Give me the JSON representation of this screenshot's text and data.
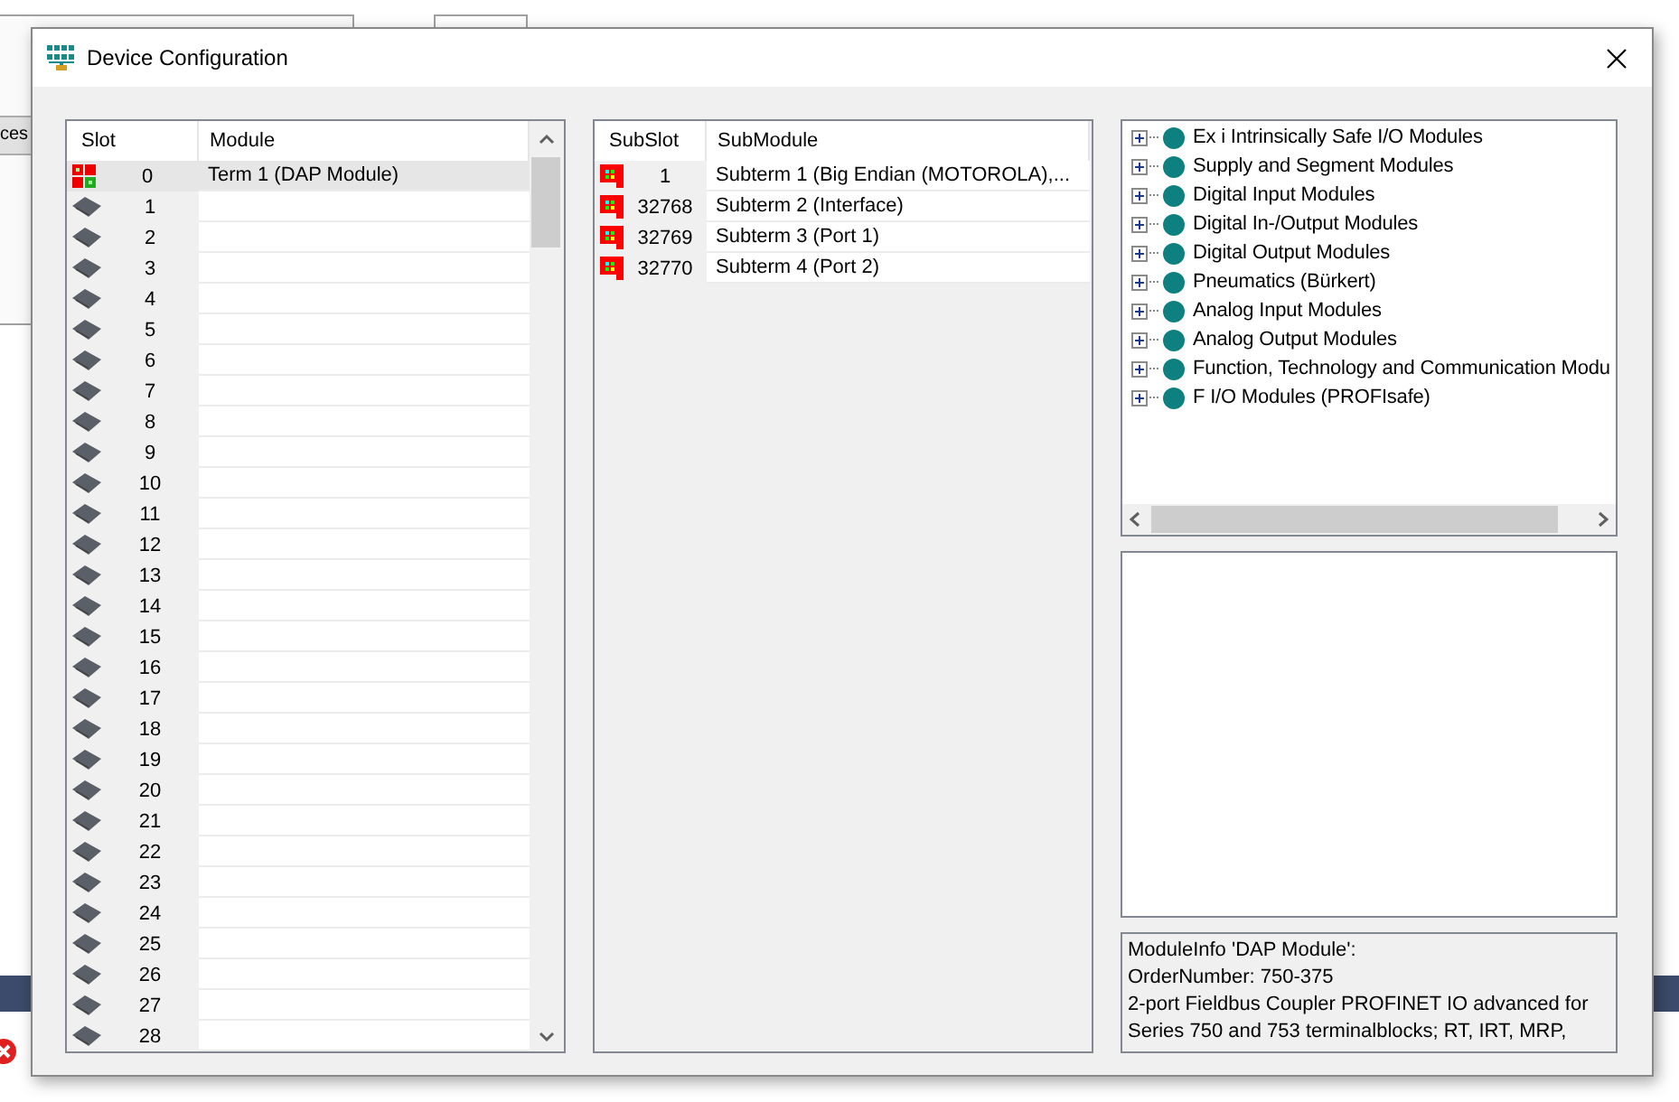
{
  "background": {
    "fragment": "ces"
  },
  "window": {
    "title": "Device Configuration"
  },
  "slot_table": {
    "columns": [
      "Slot",
      "Module"
    ],
    "rows": [
      {
        "slot": "0",
        "module": "Term 1 (DAP Module)",
        "kind": "dap",
        "selected": true
      },
      {
        "slot": "1",
        "kind": "empty",
        "selected": false
      },
      {
        "slot": "2",
        "kind": "empty",
        "selected": false
      },
      {
        "slot": "3",
        "kind": "empty",
        "selected": false
      },
      {
        "slot": "4",
        "kind": "empty",
        "selected": false
      },
      {
        "slot": "5",
        "kind": "empty",
        "selected": false
      },
      {
        "slot": "6",
        "kind": "empty",
        "selected": false
      },
      {
        "slot": "7",
        "kind": "empty",
        "selected": false
      },
      {
        "slot": "8",
        "kind": "empty",
        "selected": false
      },
      {
        "slot": "9",
        "kind": "empty",
        "selected": false
      },
      {
        "slot": "10",
        "kind": "empty",
        "selected": false
      },
      {
        "slot": "11",
        "kind": "empty",
        "selected": false
      },
      {
        "slot": "12",
        "kind": "empty",
        "selected": false
      },
      {
        "slot": "13",
        "kind": "empty",
        "selected": false
      },
      {
        "slot": "14",
        "kind": "empty",
        "selected": false
      },
      {
        "slot": "15",
        "kind": "empty",
        "selected": false
      },
      {
        "slot": "16",
        "kind": "empty",
        "selected": false
      },
      {
        "slot": "17",
        "kind": "empty",
        "selected": false
      },
      {
        "slot": "18",
        "kind": "empty",
        "selected": false
      },
      {
        "slot": "19",
        "kind": "empty",
        "selected": false
      },
      {
        "slot": "20",
        "kind": "empty",
        "selected": false
      },
      {
        "slot": "21",
        "kind": "empty",
        "selected": false
      },
      {
        "slot": "22",
        "kind": "empty",
        "selected": false
      },
      {
        "slot": "23",
        "kind": "empty",
        "selected": false
      },
      {
        "slot": "24",
        "kind": "empty",
        "selected": false
      },
      {
        "slot": "25",
        "kind": "empty",
        "selected": false
      },
      {
        "slot": "26",
        "kind": "empty",
        "selected": false
      },
      {
        "slot": "27",
        "kind": "empty",
        "selected": false
      },
      {
        "slot": "28",
        "kind": "empty",
        "selected": false
      }
    ]
  },
  "submodule_table": {
    "columns": [
      "SubSlot",
      "SubModule"
    ],
    "rows": [
      {
        "subslot": "1",
        "submodule": "Subterm 1 (Big Endian (MOTOROLA),..."
      },
      {
        "subslot": "32768",
        "submodule": "Subterm 2 (Interface)"
      },
      {
        "subslot": "32769",
        "submodule": "Subterm 3 (Port 1)"
      },
      {
        "subslot": "32770",
        "submodule": "Subterm 4 (Port 2)"
      }
    ]
  },
  "module_tree": {
    "items": [
      {
        "label": "Ex i Intrinsically Safe I/O Modules",
        "expanded": false
      },
      {
        "label": "Supply and Segment Modules",
        "expanded": false
      },
      {
        "label": "Digital Input Modules",
        "expanded": false
      },
      {
        "label": "Digital In-/Output Modules",
        "expanded": false
      },
      {
        "label": "Digital Output Modules",
        "expanded": false
      },
      {
        "label": "Pneumatics (Bürkert)",
        "expanded": false
      },
      {
        "label": "Analog Input Modules",
        "expanded": false
      },
      {
        "label": "Analog Output Modules",
        "expanded": false
      },
      {
        "label": "Function, Technology and Communication Modu",
        "expanded": false
      },
      {
        "label": "F I/O Modules (PROFIsafe)",
        "expanded": false
      }
    ]
  },
  "module_info": {
    "lines": [
      "ModuleInfo 'DAP Module':",
      "OrderNumber: 750-375",
      "2-port Fieldbus Coupler PROFINET IO advanced for",
      "Series 750 and 753 terminalblocks; RT, IRT, MRP,"
    ]
  }
}
